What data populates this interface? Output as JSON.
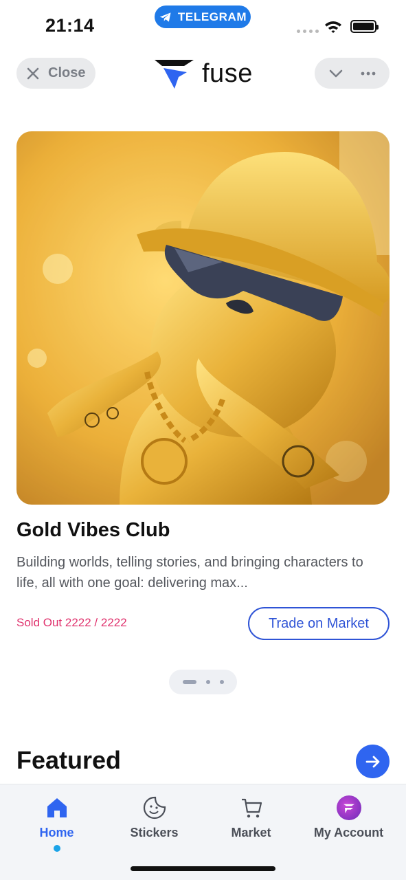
{
  "status_bar": {
    "time": "21:14",
    "telegram_label": "TELEGRAM"
  },
  "header": {
    "close_label": "Close",
    "brand_name": "fuse",
    "icons": [
      "close-icon",
      "fuse-logo-icon",
      "chevron-down-icon",
      "more-icon"
    ]
  },
  "hero": {
    "title": "Gold Vibes Club",
    "description": "Building worlds, telling stories, and bringing characters to life, all with one goal: delivering max...",
    "sold_out_label": "Sold Out 2222 / 2222",
    "trade_button_label": "Trade on Market",
    "pager_count": 3,
    "pager_active_index": 0
  },
  "featured": {
    "title": "Featured"
  },
  "bottom_nav": {
    "items": [
      {
        "label": "Home",
        "icon": "home-icon",
        "active": true
      },
      {
        "label": "Stickers",
        "icon": "sticker-icon",
        "active": false
      },
      {
        "label": "Market",
        "icon": "market-cart-icon",
        "active": false
      },
      {
        "label": "My Account",
        "icon": "avatar",
        "active": false
      }
    ]
  },
  "colors": {
    "accent_blue": "#2f65f0",
    "telegram_blue": "#1f7ae8",
    "sold_out_pink": "#e0336e",
    "active_dot": "#1aa3e8"
  }
}
